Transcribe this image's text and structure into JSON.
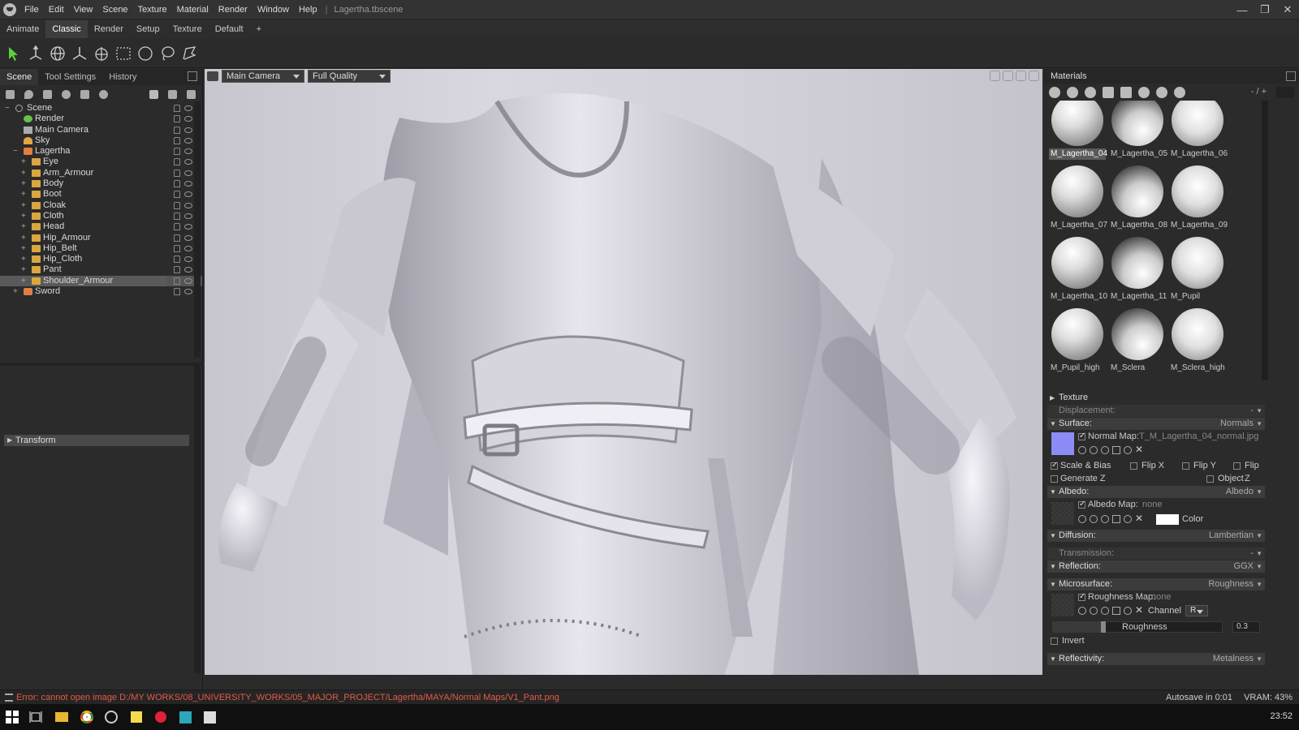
{
  "app": {
    "title": "Lagertha.tbscene",
    "menu": [
      "File",
      "Edit",
      "View",
      "Scene",
      "Texture",
      "Material",
      "Render",
      "Window",
      "Help"
    ],
    "window_controls": [
      "minimize-icon",
      "restore-icon",
      "close-icon"
    ]
  },
  "workspace_tabs": [
    "Animate",
    "Classic",
    "Render",
    "Setup",
    "Texture",
    "Default",
    "+"
  ],
  "active_workspace": "Classic",
  "tools": [
    "select-arrow-icon",
    "transform-icon",
    "rotate-globe-icon",
    "axis-icon",
    "scale-icon",
    "rect-select-icon",
    "circle-select-icon",
    "lasso-icon",
    "paint-select-icon"
  ],
  "left_panel": {
    "tabs": [
      "Scene",
      "Tool Settings",
      "History"
    ],
    "active_tab": "Scene",
    "tree": [
      {
        "label": "Scene",
        "icon": "scene",
        "depth": 0,
        "exp": "−"
      },
      {
        "label": "Render",
        "icon": "gear",
        "depth": 1,
        "exp": ""
      },
      {
        "label": "Main Camera",
        "icon": "cam",
        "depth": 1,
        "exp": ""
      },
      {
        "label": "Sky",
        "icon": "sky",
        "depth": 1,
        "exp": ""
      },
      {
        "label": "Lagertha",
        "icon": "char",
        "depth": 1,
        "exp": "−"
      },
      {
        "label": "Eye",
        "icon": "folder",
        "depth": 2,
        "exp": "+"
      },
      {
        "label": "Arm_Armour",
        "icon": "folder",
        "depth": 2,
        "exp": "+"
      },
      {
        "label": "Body",
        "icon": "folder",
        "depth": 2,
        "exp": "+"
      },
      {
        "label": "Boot",
        "icon": "folder",
        "depth": 2,
        "exp": "+"
      },
      {
        "label": "Cloak",
        "icon": "folder",
        "depth": 2,
        "exp": "+"
      },
      {
        "label": "Cloth",
        "icon": "folder",
        "depth": 2,
        "exp": "+"
      },
      {
        "label": "Head",
        "icon": "folder",
        "depth": 2,
        "exp": "+"
      },
      {
        "label": "Hip_Armour",
        "icon": "folder",
        "depth": 2,
        "exp": "+"
      },
      {
        "label": "Hip_Belt",
        "icon": "folder",
        "depth": 2,
        "exp": "+"
      },
      {
        "label": "Hip_Cloth",
        "icon": "folder",
        "depth": 2,
        "exp": "+"
      },
      {
        "label": "Pant",
        "icon": "folder",
        "depth": 2,
        "exp": "+"
      },
      {
        "label": "Shoulder_Armour",
        "icon": "folder",
        "depth": 2,
        "exp": "+",
        "selected": true
      },
      {
        "label": "Sword",
        "icon": "char",
        "depth": 1,
        "exp": "+"
      }
    ],
    "transform_section": "Transform"
  },
  "viewport": {
    "camera": "Main Camera",
    "quality": "Full Quality"
  },
  "materials_panel": {
    "title": "Materials",
    "count": "- / +",
    "materials": [
      {
        "name": "M_Lagertha_04",
        "selected": true
      },
      {
        "name": "M_Lagertha_05"
      },
      {
        "name": "M_Lagertha_06"
      },
      {
        "name": "M_Lagertha_07"
      },
      {
        "name": "M_Lagertha_08"
      },
      {
        "name": "M_Lagertha_09"
      },
      {
        "name": "M_Lagertha_10"
      },
      {
        "name": "M_Lagertha_11"
      },
      {
        "name": "M_Pupil"
      },
      {
        "name": "M_Pupil_high"
      },
      {
        "name": "M_Sclera"
      },
      {
        "name": "M_Sclera_high"
      }
    ]
  },
  "properties": {
    "texture": "Texture",
    "displacement": {
      "label": "Displacement:",
      "value": "-"
    },
    "surface": {
      "label": "Surface:",
      "value": "Normals"
    },
    "normal_map": {
      "label": "Normal Map:",
      "file": "T_M_Lagertha_04_normal.jpg"
    },
    "scale_bias": "Scale & Bias",
    "flip_x": "Flip X",
    "flip_y": "Flip Y",
    "flip_z": "Flip Z",
    "generate_z": "Generate Z",
    "object_space": "Object Space",
    "albedo": {
      "label": "Albedo:",
      "value": "Albedo"
    },
    "albedo_map": {
      "label": "Albedo Map:",
      "file": "none"
    },
    "color_label": "Color",
    "diffusion": {
      "label": "Diffusion:",
      "value": "Lambertian"
    },
    "transmission": {
      "label": "Transmission:",
      "value": "-"
    },
    "reflection": {
      "label": "Reflection:",
      "value": "GGX"
    },
    "microsurface": {
      "label": "Microsurface:",
      "value": "Roughness"
    },
    "roughness_map": {
      "label": "Roughness Map:",
      "file": "none"
    },
    "channel_label": "Channel",
    "channel_value": "R",
    "roughness_label": "Roughness",
    "roughness_value": "0.3",
    "invert": "Invert",
    "reflectivity": {
      "label": "Reflectivity:",
      "value": "Metalness"
    }
  },
  "status": {
    "error": "Error: cannot open image D:/MY WORKS/08_UNIVERSITY_WORKS/05_MAJOR_PROJECT/Lagertha/MAYA/Normal Maps/V1_Pant.png",
    "autosave": "Autosave in 0:01",
    "vram": "VRAM: 43%"
  },
  "taskbar": {
    "icons": [
      "windows-start-icon",
      "task-view-icon",
      "file-explorer-icon",
      "chrome-icon",
      "media-icon",
      "sticky-notes-icon",
      "record-icon",
      "maya-icon",
      "toolbag-icon"
    ],
    "clock": "23:52"
  },
  "colors": {
    "error": "#e25a4a",
    "accent_normal": "#8b8cf5"
  }
}
